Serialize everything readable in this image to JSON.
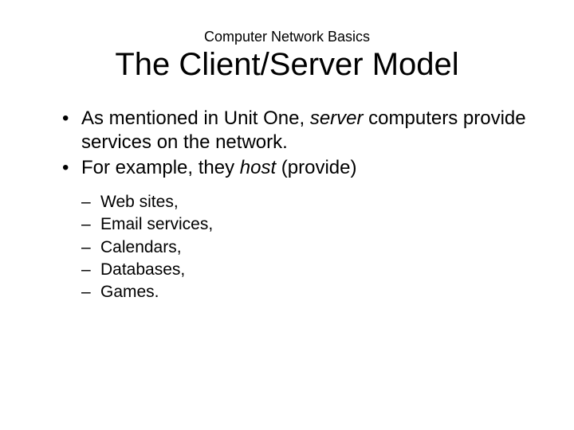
{
  "overtitle": "Computer Network Basics",
  "title": "The Client/Server Model",
  "bullet1_pre": "As mentioned in Unit One, ",
  "bullet1_em": "server",
  "bullet1_post": " computers provide services on the network.",
  "bullet2_pre": "For example, they ",
  "bullet2_em": "host",
  "bullet2_post": " (provide)",
  "sub": {
    "a": "Web sites,",
    "b": "Email services,",
    "c": "Calendars,",
    "d": "Databases,",
    "e": "Games."
  }
}
